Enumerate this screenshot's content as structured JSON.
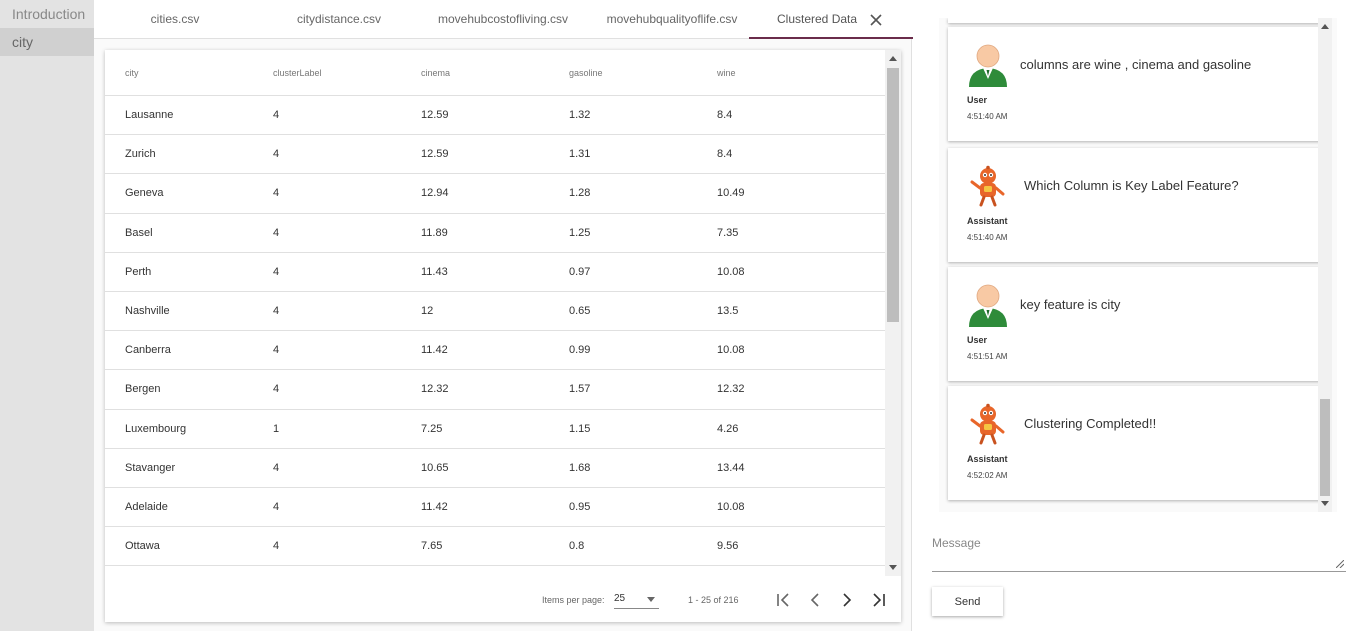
{
  "sidebar": {
    "items": [
      {
        "label": "Introduction"
      },
      {
        "label": "city"
      }
    ]
  },
  "tabs": [
    {
      "label": "cities.csv"
    },
    {
      "label": "citydistance.csv"
    },
    {
      "label": "movehubcostofliving.csv"
    },
    {
      "label": "movehubqualityoflife.csv"
    },
    {
      "label": "Clustered Data"
    }
  ],
  "close_icon": "close-icon",
  "table": {
    "columns": [
      "city",
      "clusterLabel",
      "cinema",
      "gasoline",
      "wine"
    ],
    "rows": [
      [
        "Lausanne",
        "4",
        "12.59",
        "1.32",
        "8.4"
      ],
      [
        "Zurich",
        "4",
        "12.59",
        "1.31",
        "8.4"
      ],
      [
        "Geneva",
        "4",
        "12.94",
        "1.28",
        "10.49"
      ],
      [
        "Basel",
        "4",
        "11.89",
        "1.25",
        "7.35"
      ],
      [
        "Perth",
        "4",
        "11.43",
        "0.97",
        "10.08"
      ],
      [
        "Nashville",
        "4",
        "12",
        "0.65",
        "13.5"
      ],
      [
        "Canberra",
        "4",
        "11.42",
        "0.99",
        "10.08"
      ],
      [
        "Bergen",
        "4",
        "12.32",
        "1.57",
        "12.32"
      ],
      [
        "Luxembourg",
        "1",
        "7.25",
        "1.15",
        "4.26"
      ],
      [
        "Stavanger",
        "4",
        "10.65",
        "1.68",
        "13.44"
      ],
      [
        "Adelaide",
        "4",
        "11.42",
        "0.95",
        "10.08"
      ],
      [
        "Ottawa",
        "4",
        "7.65",
        "0.8",
        "9.56"
      ]
    ]
  },
  "paginator": {
    "items_per_page_label": "Items per page:",
    "page_size": "25",
    "range_label": "1 - 25 of 216"
  },
  "chat": {
    "messages": [
      {
        "role": "User",
        "text": "columns are wine , cinema and gasoline",
        "time": "4:51:40 AM"
      },
      {
        "role": "Assistant",
        "text": "Which Column is Key Label Feature?",
        "time": "4:51:40 AM"
      },
      {
        "role": "User",
        "text": "key feature is city",
        "time": "4:51:51 AM"
      },
      {
        "role": "Assistant",
        "text": "Clustering Completed!!",
        "time": "4:52:02 AM"
      }
    ],
    "input_placeholder": "Message",
    "send_label": "Send"
  },
  "colors": {
    "tab_active_underline": "#6a2c4a",
    "user_avatar_green": "#2e8b3a",
    "assistant_avatar_orange": "#e8662a"
  }
}
